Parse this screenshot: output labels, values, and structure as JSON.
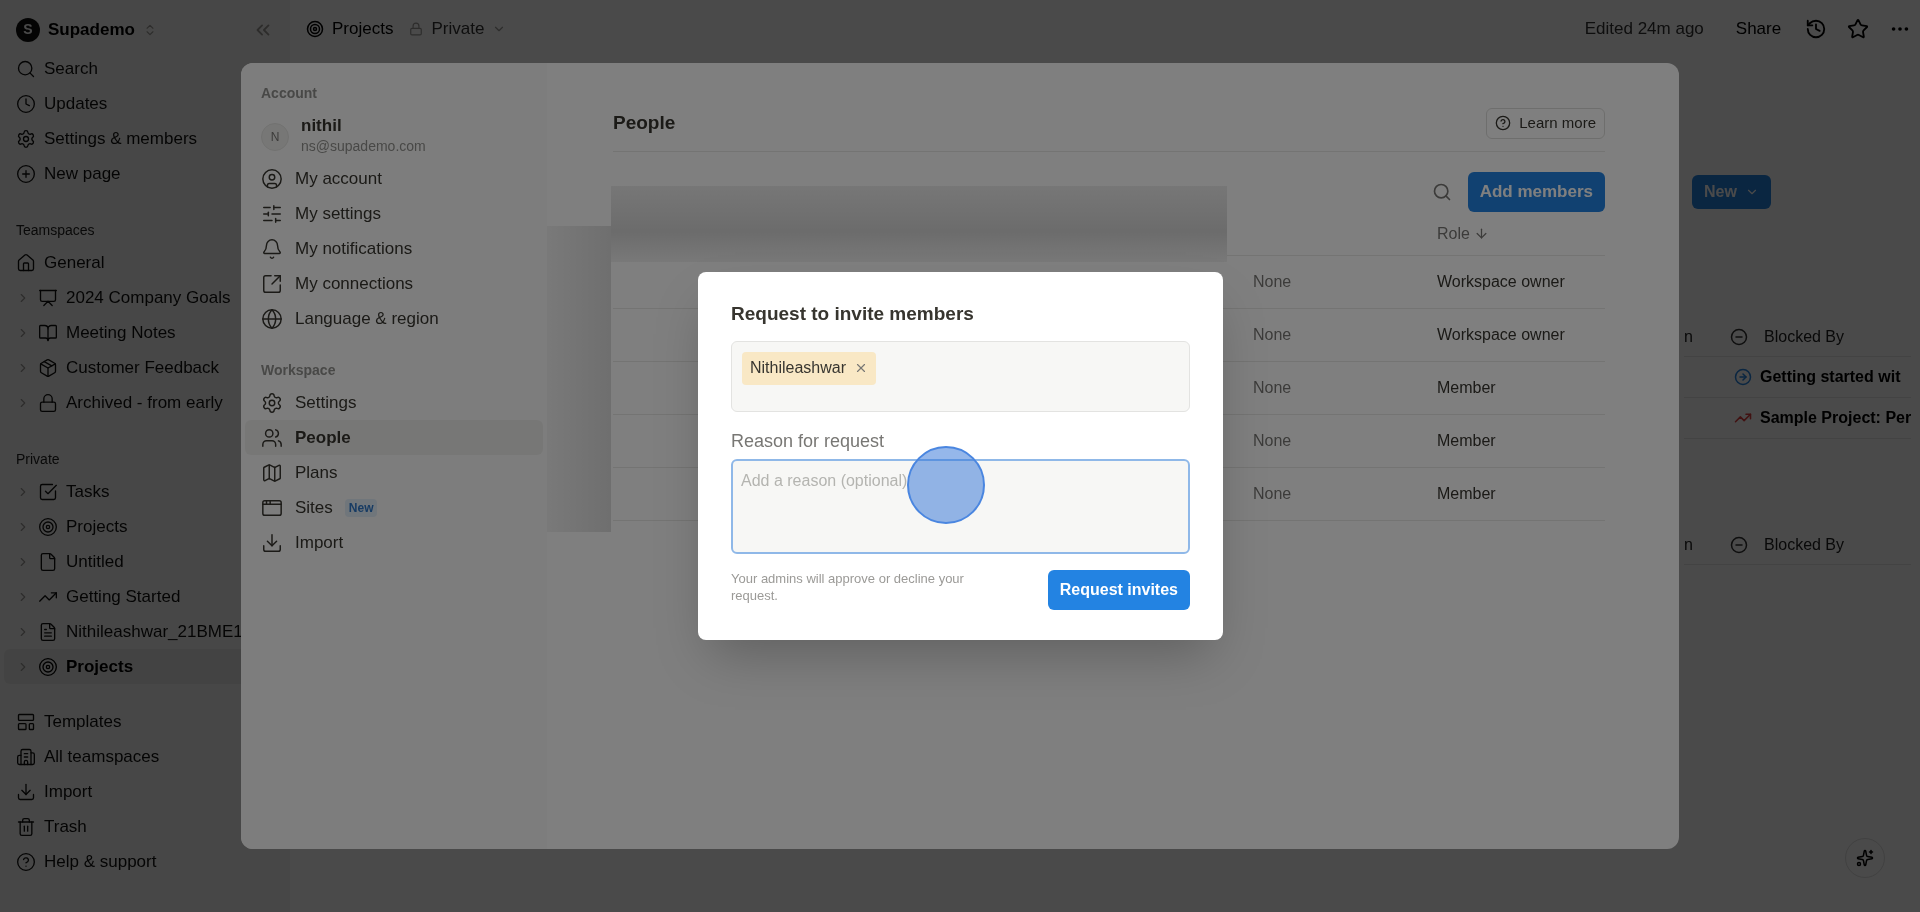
{
  "topbar": {
    "logo_letter": "S",
    "workspace": "Supademo",
    "breadcrumb": "Projects",
    "privacy": "Private",
    "edited": "Edited 24m ago",
    "share": "Share"
  },
  "sidebar": {
    "nav": [
      {
        "kind": "search",
        "label": "Search"
      },
      {
        "kind": "updates",
        "label": "Updates"
      },
      {
        "kind": "settings",
        "label": "Settings & members"
      },
      {
        "kind": "new",
        "label": "New page"
      }
    ],
    "teamspaces_label": "Teamspaces",
    "teamspaces": [
      {
        "kind": "home",
        "label": "General",
        "selected": false
      },
      {
        "kind": "goals",
        "label": "2024 Company Goals",
        "selected": false
      },
      {
        "kind": "notes",
        "label": "Meeting Notes",
        "selected": false
      },
      {
        "kind": "feedback",
        "label": "Customer Feedback",
        "selected": false
      },
      {
        "kind": "lock",
        "label": "Archived - from early",
        "selected": false
      }
    ],
    "private_label": "Private",
    "private": [
      {
        "kind": "check",
        "label": "Tasks",
        "selected": false
      },
      {
        "kind": "target",
        "label": "Projects",
        "selected": false
      },
      {
        "kind": "page",
        "label": "Untitled",
        "selected": false
      },
      {
        "kind": "chart",
        "label": "Getting Started",
        "selected": false
      },
      {
        "kind": "doc",
        "label": "Nithileashwar_21BME1",
        "selected": false
      },
      {
        "kind": "target",
        "label": "Projects",
        "selected": true
      }
    ],
    "bottom": [
      {
        "kind": "templates",
        "label": "Templates"
      },
      {
        "kind": "teamspaces",
        "label": "All teamspaces"
      },
      {
        "kind": "import",
        "label": "Import"
      },
      {
        "kind": "trash",
        "label": "Trash"
      },
      {
        "kind": "help",
        "label": "Help & support"
      }
    ]
  },
  "page": {
    "new_button": "New",
    "tables": [
      {
        "column_1": "n",
        "blocked_by": "Blocked By",
        "rows": [
          {
            "kind": "arrow",
            "title": "Getting started wit"
          },
          {
            "kind": "chart",
            "title": "Sample Project: Per"
          }
        ]
      },
      {
        "column_1": "n",
        "blocked_by": "Blocked By"
      }
    ]
  },
  "settings": {
    "account_label": "Account",
    "user": {
      "initial": "N",
      "name": "nithil",
      "email": "ns@supademo.com"
    },
    "account_items": [
      {
        "kind": "account",
        "label": "My account",
        "selected": false
      },
      {
        "kind": "sliders",
        "label": "My settings",
        "selected": false
      },
      {
        "kind": "bell",
        "label": "My notifications",
        "selected": false
      },
      {
        "kind": "link",
        "label": "My connections",
        "selected": false
      },
      {
        "kind": "globe",
        "label": "Language & region",
        "selected": false
      }
    ],
    "workspace_label": "Workspace",
    "workspace_items": [
      {
        "kind": "gear",
        "label": "Settings",
        "selected": false
      },
      {
        "kind": "people",
        "label": "People",
        "selected": true
      },
      {
        "kind": "map",
        "label": "Plans",
        "selected": false
      },
      {
        "kind": "sites",
        "label": "Sites",
        "badge": "New",
        "selected": false
      },
      {
        "kind": "import",
        "label": "Import",
        "selected": false
      }
    ],
    "title": "People",
    "learn_more": "Learn more",
    "add_members": "Add members",
    "table": {
      "role_header": "Role",
      "rows": [
        {
          "column_2": "None",
          "role": "Workspace owner"
        },
        {
          "column_2": "None",
          "role": "Workspace owner"
        },
        {
          "column_2": "None",
          "role": "Member"
        },
        {
          "column_2": "None",
          "role": "Member"
        },
        {
          "column_2": "None",
          "role": "Member"
        }
      ]
    }
  },
  "dialog": {
    "title": "Request to invite members",
    "chips": [
      "Nithileashwar"
    ],
    "reason_label": "Reason for request",
    "reason_placeholder": "Add a reason (optional)",
    "note": "Your admins will approve or decline your request.",
    "submit": "Request invites"
  }
}
